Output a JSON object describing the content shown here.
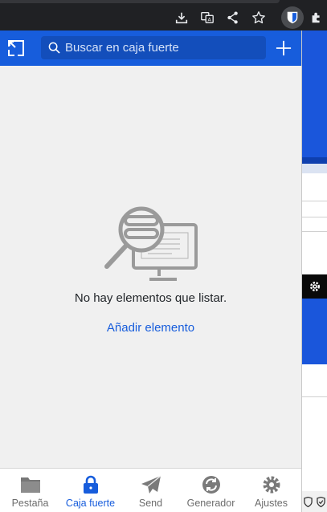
{
  "header": {
    "search_placeholder": "Buscar en caja fuerte"
  },
  "empty_state": {
    "message": "No hay elementos que listar.",
    "add_label": "Añadir elemento"
  },
  "bottom_nav": {
    "items": [
      {
        "label": "Pestaña",
        "icon": "folder-icon",
        "active": false
      },
      {
        "label": "Caja fuerte",
        "icon": "lock-icon",
        "active": true
      },
      {
        "label": "Send",
        "icon": "paper-plane-icon",
        "active": false
      },
      {
        "label": "Generador",
        "icon": "generate-icon",
        "active": false
      },
      {
        "label": "Ajustes",
        "icon": "gear-icon",
        "active": false
      }
    ]
  },
  "colors": {
    "brand_blue": "#175ddc",
    "popup_background": "#f0f0f0",
    "chrome_toolbar": "#202124"
  }
}
